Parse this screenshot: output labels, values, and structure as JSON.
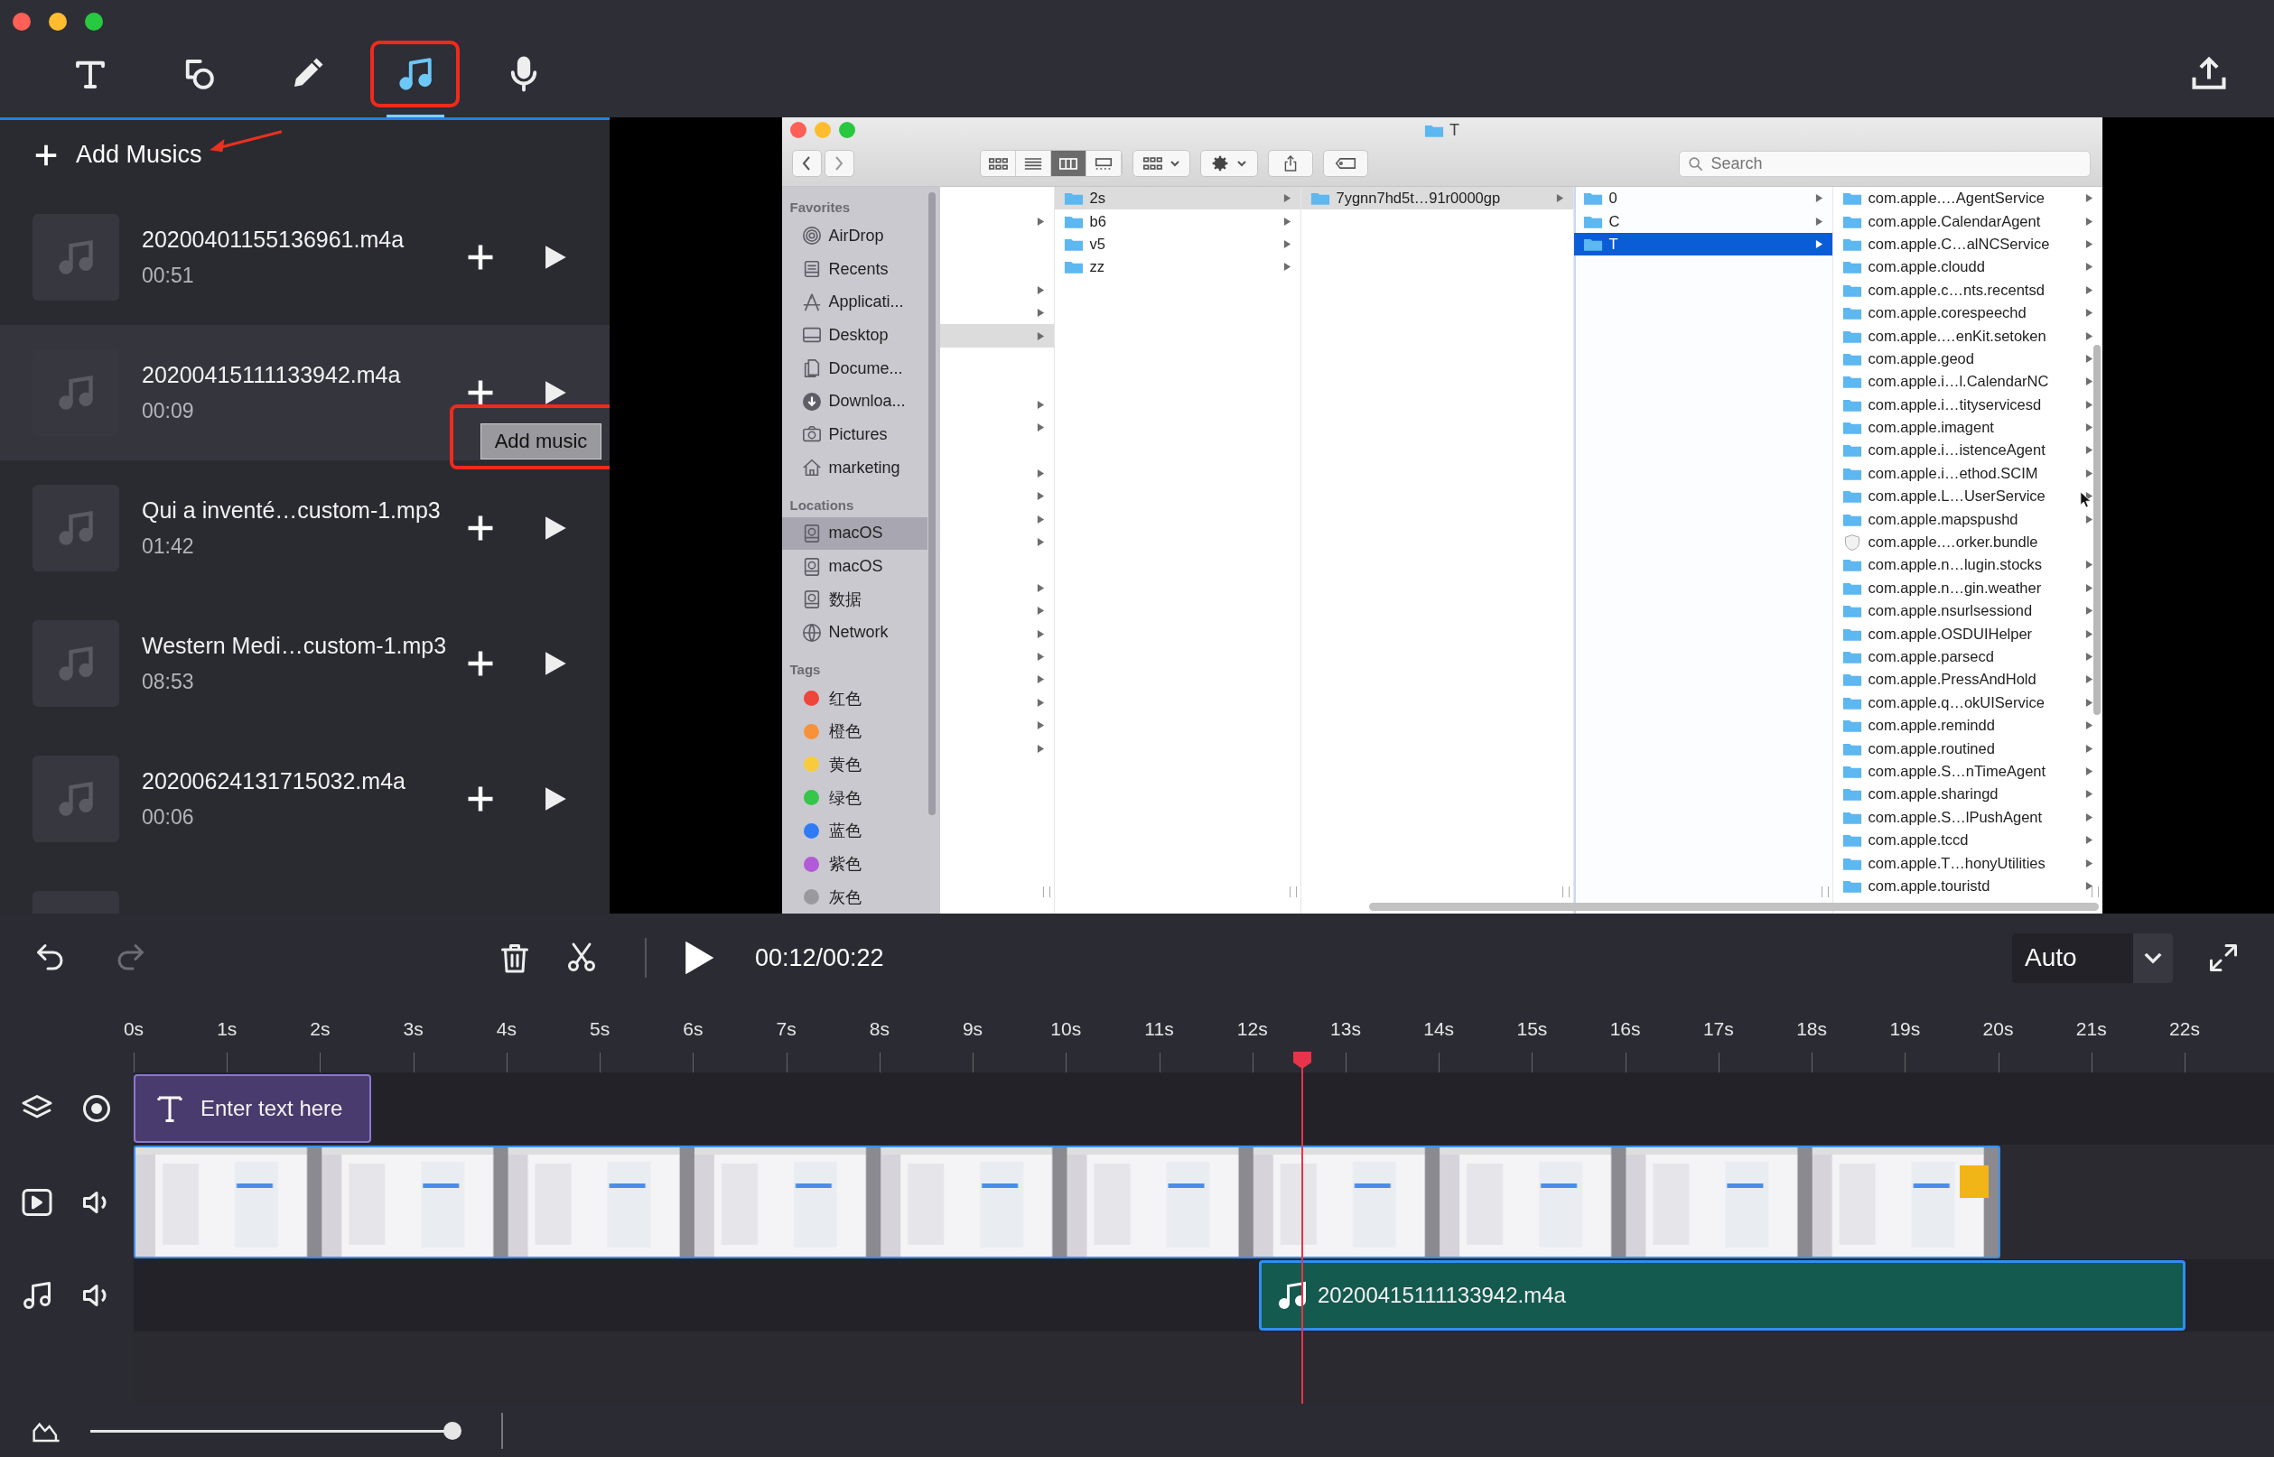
{
  "toolbar": {
    "tools": [
      {
        "kind": "text",
        "selected": false
      },
      {
        "kind": "shape",
        "selected": false
      },
      {
        "kind": "pen",
        "selected": false
      },
      {
        "kind": "music",
        "selected": true
      },
      {
        "kind": "mic",
        "selected": false
      }
    ]
  },
  "music_panel": {
    "add_label": "Add Musics",
    "tooltip": "Add music",
    "items": [
      {
        "title": "20200401155136961.m4a",
        "duration": "00:51",
        "highlighted": false
      },
      {
        "title": "20200415111133942.m4a",
        "duration": "00:09",
        "highlighted": true
      },
      {
        "title": "Qui a inventé…custom-1.mp3",
        "duration": "01:42",
        "highlighted": false
      },
      {
        "title": "Western Medi…custom-1.mp3",
        "duration": "08:53",
        "highlighted": false
      },
      {
        "title": "20200624131715032.m4a",
        "duration": "00:06",
        "highlighted": false
      },
      {
        "highlighted": false
      }
    ]
  },
  "finder": {
    "title": "T",
    "search": {
      "placeholder": "Search"
    },
    "view_modes": [
      {
        "kind": "icons",
        "selected": false
      },
      {
        "kind": "list",
        "selected": false
      },
      {
        "kind": "columns",
        "selected": true
      },
      {
        "kind": "gallery",
        "selected": false
      }
    ],
    "sidebar": [
      {
        "header": "Favorites",
        "items": [
          {
            "label": "AirDrop",
            "kind": "airdrop",
            "selected": false
          },
          {
            "label": "Recents",
            "kind": "recents",
            "selected": false
          },
          {
            "label": "Applicati...",
            "kind": "apps",
            "selected": false
          },
          {
            "label": "Desktop",
            "kind": "desktop",
            "selected": false
          },
          {
            "label": "Docume...",
            "kind": "documents",
            "selected": false
          },
          {
            "label": "Downloa...",
            "kind": "downloads",
            "selected": false
          },
          {
            "label": "Pictures",
            "kind": "pictures",
            "selected": false
          },
          {
            "label": "marketing",
            "kind": "home",
            "selected": false
          }
        ]
      },
      {
        "header": "Locations",
        "items": [
          {
            "label": "macOS",
            "kind": "disk",
            "selected": true
          },
          {
            "label": "macOS",
            "kind": "disk",
            "selected": false
          },
          {
            "label": "数据",
            "kind": "disk",
            "selected": false
          },
          {
            "label": "Network",
            "kind": "network",
            "selected": false
          }
        ]
      },
      {
        "header": "Tags",
        "items": [
          {
            "label": "红色",
            "kind": "tag",
            "color": "#f0453a",
            "selected": false
          },
          {
            "label": "橙色",
            "kind": "tag",
            "color": "#f7923a",
            "selected": false
          },
          {
            "label": "黄色",
            "kind": "tag",
            "color": "#f8cb3d",
            "selected": false
          },
          {
            "label": "绿色",
            "kind": "tag",
            "color": "#35c64a",
            "selected": false
          },
          {
            "label": "蓝色",
            "kind": "tag",
            "color": "#2f7bf5",
            "selected": false
          },
          {
            "label": "紫色",
            "kind": "tag",
            "color": "#b35ad8",
            "selected": false
          },
          {
            "label": "灰色",
            "kind": "tag",
            "color": "#9a9a9e",
            "selected": false
          }
        ]
      }
    ],
    "columns": [
      {
        "focused": false,
        "rows": [
          {
            "expandable": false,
            "selected": false
          },
          {
            "expandable": true,
            "selected": false
          },
          {
            "expandable": false,
            "selected": false
          },
          {
            "expandable": false,
            "selected": false
          },
          {
            "expandable": true,
            "selected": false
          },
          {
            "expandable": true,
            "selected": false
          },
          {
            "expandable": true,
            "selected": true
          },
          {
            "expandable": false,
            "selected": false
          },
          {
            "expandable": false,
            "selected": false
          },
          {
            "expandable": true,
            "selected": false
          },
          {
            "expandable": true,
            "selected": false
          },
          {
            "expandable": false,
            "selected": false
          },
          {
            "expandable": true,
            "selected": false
          },
          {
            "expandable": true,
            "selected": false
          },
          {
            "expandable": true,
            "selected": false
          },
          {
            "expandable": true,
            "selected": false
          },
          {
            "expandable": false,
            "selected": false
          },
          {
            "expandable": true,
            "selected": false
          },
          {
            "expandable": true,
            "selected": false
          },
          {
            "expandable": true,
            "selected": false
          },
          {
            "expandable": true,
            "selected": false
          },
          {
            "expandable": true,
            "selected": false
          },
          {
            "expandable": true,
            "selected": false
          },
          {
            "expandable": true,
            "selected": false
          },
          {
            "expandable": true,
            "selected": false
          }
        ]
      },
      {
        "focused": false,
        "rows": [
          {
            "label": "2s",
            "kind": "folder",
            "expandable": true,
            "selected": true
          },
          {
            "label": "b6",
            "kind": "folder",
            "expandable": true,
            "selected": false
          },
          {
            "label": "v5",
            "kind": "folder",
            "expandable": true,
            "selected": false
          },
          {
            "label": "zz",
            "kind": "folder",
            "expandable": true,
            "selected": false
          }
        ]
      },
      {
        "focused": false,
        "rows": [
          {
            "label": "7ygnn7hd5t…91r0000gp",
            "kind": "folder",
            "expandable": true,
            "selected": true
          }
        ]
      },
      {
        "focused": true,
        "rows": [
          {
            "label": "0",
            "kind": "folder",
            "expandable": true,
            "selected": false
          },
          {
            "label": "C",
            "kind": "folder",
            "expandable": true,
            "selected": false
          },
          {
            "label": "T",
            "kind": "folder",
            "expandable": true,
            "selected": true
          }
        ]
      },
      {
        "focused": false,
        "rows": [
          {
            "label": "com.apple.…AgentService",
            "kind": "folder",
            "expandable": true,
            "selected": false
          },
          {
            "label": "com.apple.CalendarAgent",
            "kind": "folder",
            "expandable": true,
            "selected": false
          },
          {
            "label": "com.apple.C…alNCService",
            "kind": "folder",
            "expandable": true,
            "selected": false
          },
          {
            "label": "com.apple.cloudd",
            "kind": "folder",
            "expandable": true,
            "selected": false
          },
          {
            "label": "com.apple.c…nts.recentsd",
            "kind": "folder",
            "expandable": true,
            "selected": false
          },
          {
            "label": "com.apple.corespeechd",
            "kind": "folder",
            "expandable": true,
            "selected": false
          },
          {
            "label": "com.apple.…enKit.setoken",
            "kind": "folder",
            "expandable": true,
            "selected": false
          },
          {
            "label": "com.apple.geod",
            "kind": "folder",
            "expandable": true,
            "selected": false
          },
          {
            "label": "com.apple.i…l.CalendarNC",
            "kind": "folder",
            "expandable": true,
            "selected": false
          },
          {
            "label": "com.apple.i…tityservicesd",
            "kind": "folder",
            "expandable": true,
            "selected": false
          },
          {
            "label": "com.apple.imagent",
            "kind": "folder",
            "expandable": true,
            "selected": false
          },
          {
            "label": "com.apple.i…istenceAgent",
            "kind": "folder",
            "expandable": true,
            "selected": false
          },
          {
            "label": "com.apple.i…ethod.SCIM",
            "kind": "folder",
            "expandable": true,
            "selected": false
          },
          {
            "label": "com.apple.L…UserService",
            "kind": "folder",
            "expandable": true,
            "selected": false
          },
          {
            "label": "com.apple.mapspushd",
            "kind": "folder",
            "expandable": true,
            "selected": false
          },
          {
            "label": "com.apple.…orker.bundle",
            "kind": "bundle",
            "expandable": false,
            "selected": false
          },
          {
            "label": "com.apple.n…lugin.stocks",
            "kind": "folder",
            "expandable": true,
            "selected": false
          },
          {
            "label": "com.apple.n…gin.weather",
            "kind": "folder",
            "expandable": true,
            "selected": false
          },
          {
            "label": "com.apple.nsurlsessiond",
            "kind": "folder",
            "expandable": true,
            "selected": false
          },
          {
            "label": "com.apple.OSDUIHelper",
            "kind": "folder",
            "expandable": true,
            "selected": false
          },
          {
            "label": "com.apple.parsecd",
            "kind": "folder",
            "expandable": true,
            "selected": false
          },
          {
            "label": "com.apple.PressAndHold",
            "kind": "folder",
            "expandable": true,
            "selected": false
          },
          {
            "label": "com.apple.q…okUIService",
            "kind": "folder",
            "expandable": true,
            "selected": false
          },
          {
            "label": "com.apple.remindd",
            "kind": "folder",
            "expandable": true,
            "selected": false
          },
          {
            "label": "com.apple.routined",
            "kind": "folder",
            "expandable": true,
            "selected": false
          },
          {
            "label": "com.apple.S…nTimeAgent",
            "kind": "folder",
            "expandable": true,
            "selected": false
          },
          {
            "label": "com.apple.sharingd",
            "kind": "folder",
            "expandable": true,
            "selected": false
          },
          {
            "label": "com.apple.S…lPushAgent",
            "kind": "folder",
            "expandable": true,
            "selected": false
          },
          {
            "label": "com.apple.tccd",
            "kind": "folder",
            "expandable": true,
            "selected": false
          },
          {
            "label": "com.apple.T…honyUtilities",
            "kind": "folder",
            "expandable": true,
            "selected": false
          },
          {
            "label": "com.apple.touristd",
            "kind": "folder",
            "expandable": true,
            "selected": false
          }
        ]
      }
    ]
  },
  "timeline": {
    "undo": {
      "disabled": false
    },
    "redo": {
      "disabled": true
    },
    "time": "00:12/00:22",
    "zoom_mode": "Auto",
    "ruler": [
      "0s",
      "1s",
      "2s",
      "3s",
      "4s",
      "5s",
      "6s",
      "7s",
      "8s",
      "9s",
      "10s",
      "11s",
      "12s",
      "13s",
      "14s",
      "15s",
      "16s",
      "17s",
      "18s",
      "19s",
      "20s",
      "21s",
      "22s"
    ],
    "playhead": {
      "level": 0.57
    },
    "tracks": [
      {
        "kind": "text",
        "label": "Enter text here"
      },
      {
        "kind": "video"
      },
      {
        "kind": "audio",
        "label": "20200415111133942.m4a"
      }
    ],
    "zoom_slider": {
      "level": 1
    }
  }
}
